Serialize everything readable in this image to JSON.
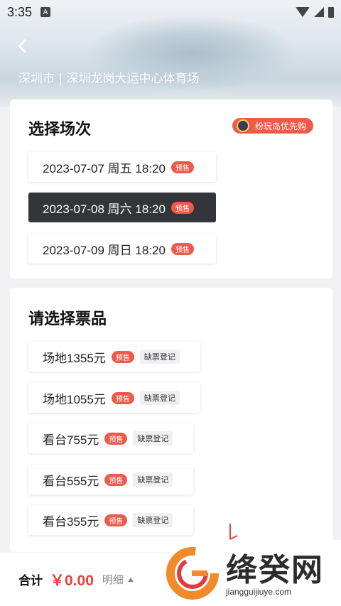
{
  "status_bar": {
    "time": "3:35",
    "notification_icon": "A"
  },
  "header": {
    "venue": "深圳市 | 深圳龙岗大运中心体育场"
  },
  "sessions": {
    "title": "选择场次",
    "priority_badge": "纷玩岛优先购",
    "items": [
      {
        "label": "2023-07-07 周五 18:20",
        "tag": "预售",
        "selected": false
      },
      {
        "label": "2023-07-08 周六 18:20",
        "tag": "预售",
        "selected": true
      },
      {
        "label": "2023-07-09 周日 18:20",
        "tag": "预售",
        "selected": false
      }
    ]
  },
  "tickets": {
    "title": "请选择票品",
    "items": [
      {
        "label": "场地1355元",
        "tag": "预售",
        "action": "缺票登记"
      },
      {
        "label": "场地1055元",
        "tag": "预售",
        "action": "缺票登记"
      },
      {
        "label": "看台755元",
        "tag": "预售",
        "action": "缺票登记"
      },
      {
        "label": "看台555元",
        "tag": "预售",
        "action": "缺票登记"
      },
      {
        "label": "看台355元",
        "tag": "预售",
        "action": "缺票登记"
      }
    ]
  },
  "bottom": {
    "total_label": "合计",
    "total_value": "￥0.00",
    "detail_label": "明细"
  },
  "watermark": {
    "title": "绛癸网",
    "url": "jiangguijiuye.com"
  },
  "colors": {
    "accent": "#ee5a4a",
    "price": "#e8413a",
    "selected_bg": "#343539"
  },
  "icons": {
    "back": "chevron-left-icon",
    "caret": "caret-up-icon",
    "wifi": "wifi-icon",
    "signal": "signal-icon",
    "battery": "battery-icon"
  }
}
